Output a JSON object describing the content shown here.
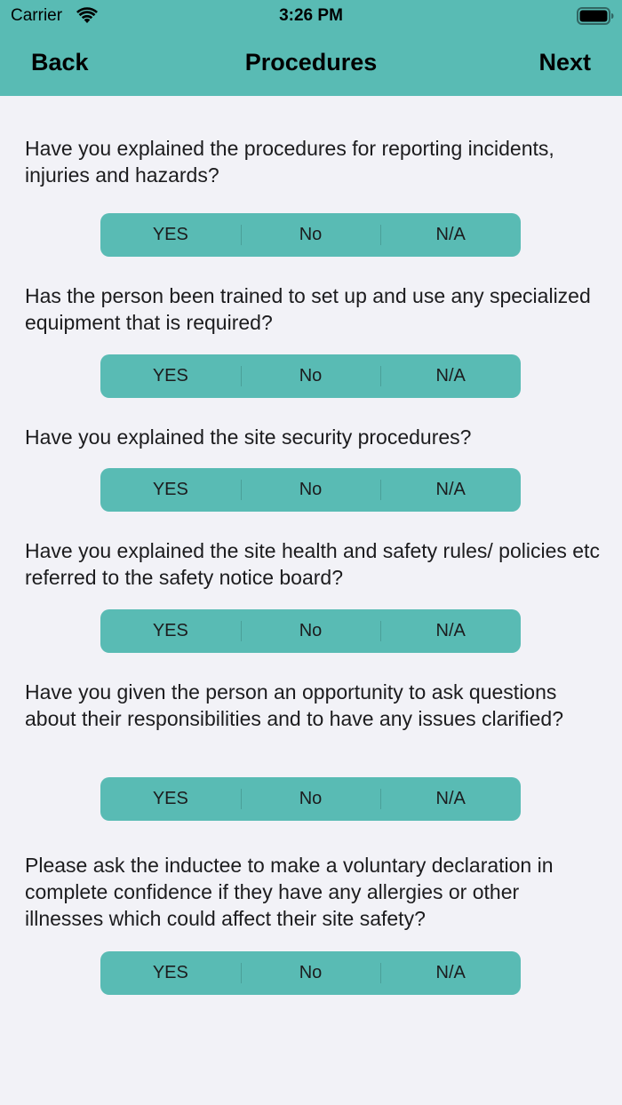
{
  "status_bar": {
    "carrier": "Carrier",
    "time": "3:26 PM",
    "wifi_icon": "wifi-icon",
    "battery_icon": "battery-full-icon"
  },
  "nav": {
    "back_label": "Back",
    "title": "Procedures",
    "next_label": "Next"
  },
  "colors": {
    "accent": "#59bbb4",
    "background": "#f2f2f7"
  },
  "questions": [
    {
      "text": "Have you explained the procedures for reporting incidents, injuries and hazards?",
      "options": [
        "YES",
        "No",
        "N/A"
      ]
    },
    {
      "text": "Has the person been trained to set up and use any specialized equipment that is required?",
      "options": [
        "YES",
        "No",
        "N/A"
      ]
    },
    {
      "text": "Have you explained the site security procedures?",
      "options": [
        "YES",
        "No",
        "N/A"
      ]
    },
    {
      "text": "Have you explained the site health and safety rules/ policies etc referred to the safety notice board?",
      "options": [
        "YES",
        "No",
        "N/A"
      ]
    },
    {
      "text": "Have you given the person an opportunity to ask questions about their responsibilities and to have any issues clarified?",
      "options": [
        "YES",
        "No",
        "N/A"
      ]
    },
    {
      "text": "Please ask the inductee to make a voluntary declaration in complete confidence if they have any allergies or other illnesses which could affect their site safety?",
      "options": [
        "YES",
        "No",
        "N/A"
      ]
    }
  ]
}
